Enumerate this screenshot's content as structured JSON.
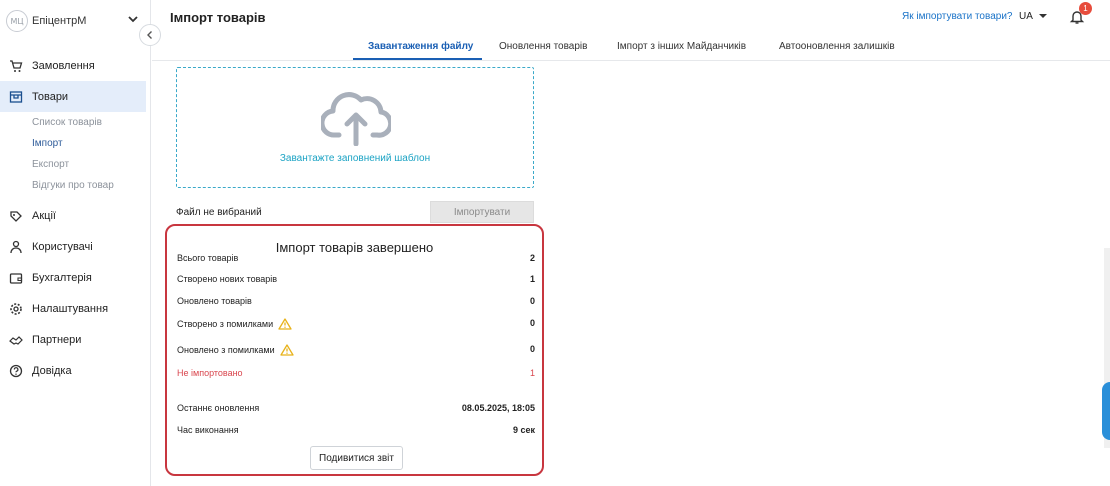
{
  "brand": {
    "logo_text": "МЦ",
    "name": "ЕпіцентрМ"
  },
  "sidebar": {
    "items": [
      {
        "label": "Замовлення",
        "icon": "cart-icon"
      },
      {
        "label": "Товари",
        "icon": "store-icon",
        "active": true
      },
      {
        "label": "Акції",
        "icon": "promo-icon"
      },
      {
        "label": "Користувачі",
        "icon": "users-icon"
      },
      {
        "label": "Бухгалтерія",
        "icon": "wallet-icon"
      },
      {
        "label": "Налаштування",
        "icon": "gear-icon"
      },
      {
        "label": "Партнери",
        "icon": "handshake-icon"
      },
      {
        "label": "Довідка",
        "icon": "help-icon"
      }
    ],
    "subitems": [
      {
        "label": "Список товарів"
      },
      {
        "label": "Імпорт",
        "current": true
      },
      {
        "label": "Експорт"
      },
      {
        "label": "Відгуки про товар"
      }
    ]
  },
  "header": {
    "title": "Імпорт товарів",
    "help_link": "Як імпортувати товари?",
    "language": "UA",
    "notifications_count": "1"
  },
  "tabs": [
    {
      "label": "Завантаження файлу",
      "active": true
    },
    {
      "label": "Оновлення товарів"
    },
    {
      "label": "Імпорт з інших Майданчиків"
    },
    {
      "label": "Автооновлення залишків"
    }
  ],
  "upload": {
    "dropzone_text": "Завантажте заповнений шаблон",
    "file_status": "Файл не вибраний",
    "import_button": "Імпортувати"
  },
  "result": {
    "title": "Імпорт товарів завершено",
    "rows": [
      {
        "label": "Всього товарів",
        "value": "2"
      },
      {
        "label": "Створено нових товарів",
        "value": "1"
      },
      {
        "label": "Оновлено товарів",
        "value": "0"
      },
      {
        "label": "Створено з помилками",
        "value": "0",
        "warning": true
      },
      {
        "label": "Оновлено з помилками",
        "value": "0",
        "warning": true
      },
      {
        "label": "Не імпортовано",
        "value": "1",
        "error": true
      },
      {
        "label": "Останнє оновлення",
        "value": "08.05.2025, 18:05"
      },
      {
        "label": "Час виконання",
        "value": "9 сек"
      }
    ],
    "report_button": "Подивитися звіт"
  },
  "colors": {
    "accent": "#1a5fb4",
    "link": "#1a73c8",
    "dropzone": "#3ba9c9",
    "error": "#d9464e",
    "warning": "#e8b21a",
    "badge": "#e74c3c"
  }
}
